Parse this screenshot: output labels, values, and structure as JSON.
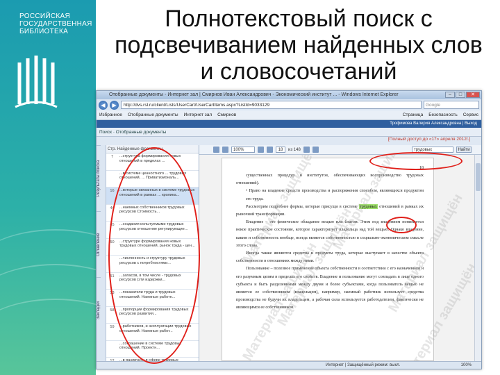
{
  "slide_title": [
    "Полнотекстовый поиск с",
    "подсвечиванием найденных слов",
    "и словосочетаний"
  ],
  "brand": {
    "lines": [
      "РОССИЙСКАЯ",
      "ГОСУДАРСТВЕННАЯ",
      "БИБЛИОТЕКА"
    ]
  },
  "browser": {
    "title": "Отобранные документы - Интернет зал | Смирнов Иван Александрович - Экономический институт ... - Windows Internet Explorer",
    "address": "http://dvs.rsl.ru/client/Lists/UserCart/UserCartItems.aspx?ListId=9033129",
    "search_placeholder": "Google",
    "favorites": [
      "Избранное",
      "Отобранные документы",
      "Интернет зал",
      "Смирнов"
    ],
    "fav_right": [
      "Страница",
      "Безопасность",
      "Сервис"
    ],
    "user_bar": "Трофимова Валерия Александровна | Выход",
    "breadcrumb": "Поиск · Отобранные документы",
    "access_note": "[Полный доступ до «17» апреля 2012г.]",
    "status_text": "Интернет | Защищённый режим: выкл.",
    "zoom_status": "100%"
  },
  "sidebar_tabs": [
    "Результаты поиска",
    "Оглавление",
    "Закладки"
  ],
  "results": {
    "header": "Стр.   Найденные фрагменты",
    "rows": [
      {
        "num": "7",
        "text": "...структура формирования новых отношений в пределах ..."
      },
      {
        "num": "",
        "text": "...в системе ценностного ... трудовых отношений, ... Приватизиональ..."
      },
      {
        "num": "16",
        "text": "...которые связанных в системе трудовых отношений в рамках ... кролика..."
      },
      {
        "num": "44",
        "text": "...наемных собственников трудовых ресурсов Стоимость..."
      },
      {
        "num": "45",
        "text": "...создания испытуемыми трудовых ресурсов отношение регулирующие..."
      },
      {
        "num": "50",
        "text": "...структуре формирования новых трудовых отношений, рынок труда - цен..."
      },
      {
        "num": "",
        "text": "...численность и структуру трудовых ресурсов с потребностями..."
      },
      {
        "num": "51",
        "text": "...запасов, в том числе - трудовых ресурсов (эти издержки..."
      },
      {
        "num": "53",
        "text": "...показатели труда и трудовых отношений. Наемные работн..."
      },
      {
        "num": "58",
        "text": "...пропорции формирования трудовых ресурсов развития..."
      },
      {
        "num": "59",
        "text": "...работников, и эксплуатации трудовых отношений. Наемные работ..."
      },
      {
        "num": "",
        "text": "...соглашение в системе трудовых отношений. Проектн..."
      },
      {
        "num": "12",
        "text": "...в различиях в сфере трудовых отношений..."
      }
    ]
  },
  "doc_toolbar": {
    "zoom": "100%",
    "page": "18",
    "page_total": "из 148",
    "search_value": "трудовых",
    "find_label": "Найти"
  },
  "document": {
    "page_number": "18",
    "watermark": "Материал защищён",
    "paragraphs": [
      {
        "type": "plain",
        "text": "существенных процедур и институтов, обеспечивающих воспроизводство трудовых отношений)."
      },
      {
        "type": "bullet",
        "text": "•  Право на владение средств производства и распоряжения способом, являющихся продуктом его труда."
      },
      {
        "type": "hl",
        "before": "Рассмотрим подробнее формы, которые присущи в системе ",
        "highlight": "трудовых",
        "after": " отношений в рамках их рыночной трансформации."
      },
      {
        "type": "plain",
        "text": "Владение – это физическое обладание вещью или благом. Этим под владением понимается некое практическое состояние, которое характеризует владельца над той вещью. Однако владение, каким и собственность вообще, всегда является собственностью в социально-экономическом смысле этого слова."
      },
      {
        "type": "plain",
        "text": "Иногда также являются средства и продукты труда, которые выступают в качестве объекта собственности в отношениях между ними."
      },
      {
        "type": "plain",
        "text": "Пользование – полезное применение объекта собственности в соответствии с его назначением и его разумным целям в пределах его свойств. Владение и пользование могут совпадать в лице одного субъекта и быть разделенными между двумя и более субъектами, когда пользователь вещью не является ее собственником (владельцем), например, наемный работник использует средства производства не будучи их владельцем, а рабочая сила используется работодателем, фактически не являющимся ее собственником."
      }
    ]
  }
}
